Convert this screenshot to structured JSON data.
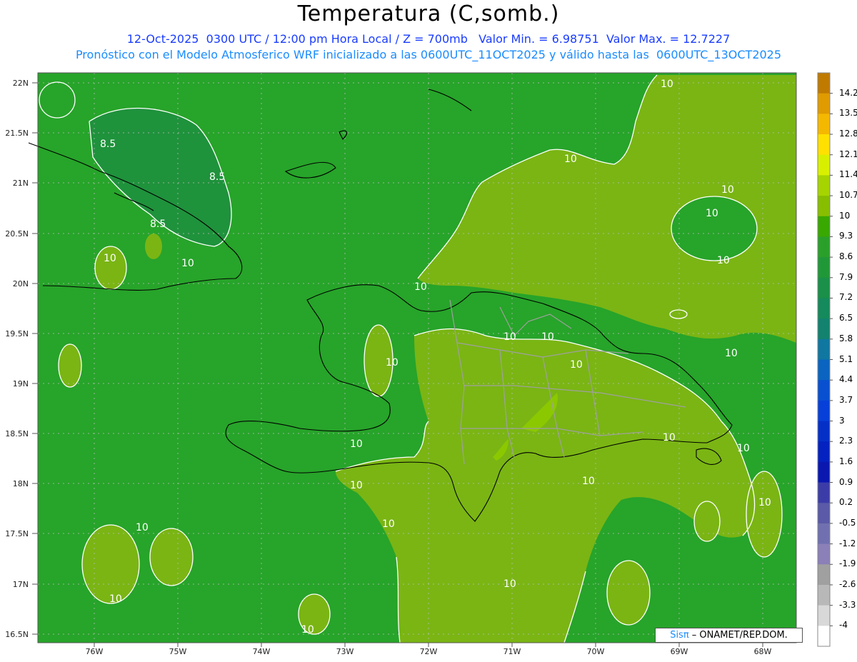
{
  "title": "Temperatura (C,somb.)",
  "subtitle_1": "12-Oct-2025  0300 UTC / 12:00 pm Hora Local / Z = 700mb   Valor Min. = 6.98751  Valor Max. = 12.7227",
  "subtitle_2": "Pronóstico con el Modelo Atmosferico WRF inicializado a las 0600UTC_11OCT2025 y válido hasta las  0600UTC_13OCT2025",
  "credit": {
    "brand": "Sisπ",
    "text": " – ONAMET/REP.DOM."
  },
  "lat_labels": [
    "22N",
    "21.5N",
    "21N",
    "20.5N",
    "20N",
    "19.5N",
    "19N",
    "18.5N",
    "18N",
    "17.5N",
    "17N",
    "16.5N"
  ],
  "lon_labels": [
    "76W",
    "75W",
    "74W",
    "73W",
    "72W",
    "71W",
    "70W",
    "69W",
    "68W"
  ],
  "contour_labels": [
    "8.5",
    "8.5",
    "8.5",
    "10",
    "10",
    "10",
    "10",
    "10",
    "10",
    "10",
    "10",
    "10",
    "10",
    "10",
    "10",
    "10",
    "10",
    "10",
    "10",
    "10",
    "10",
    "10",
    "10",
    "10",
    "10",
    "10",
    "10"
  ],
  "colorbar": {
    "labels": [
      "14.2",
      "13.5",
      "12.8",
      "12.1",
      "11.4",
      "10.7",
      "10",
      "9.3",
      "8.6",
      "7.9",
      "7.2",
      "6.5",
      "5.8",
      "5.1",
      "4.4",
      "3.7",
      "3",
      "2.3",
      "1.6",
      "0.9",
      "0.2",
      "-0.5",
      "-1.2",
      "-1.9",
      "-2.6",
      "-3.3",
      "-4"
    ],
    "colors": [
      "#c07a00",
      "#e09b00",
      "#f5b800",
      "#ffe000",
      "#d8f000",
      "#a6d400",
      "#88be00",
      "#39a800",
      "#2aa02a",
      "#209838",
      "#1a9048",
      "#158a5c",
      "#13826e",
      "#1077a0",
      "#0a64c0",
      "#0850d0",
      "#0640d8",
      "#0530c8",
      "#0422c0",
      "#0a18b0",
      "#3c3ca8",
      "#5a5aa8",
      "#7070b0",
      "#8c80b8",
      "#a0a0a0",
      "#b8b8b8",
      "#d8d8d8",
      "#ffffff"
    ]
  },
  "colors": {
    "ocean": "#27a42a",
    "warm": "#7ab514",
    "cool": "#1f8f40"
  }
}
